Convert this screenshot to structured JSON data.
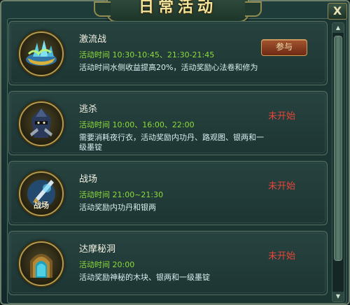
{
  "window": {
    "title": "日常活动",
    "close_label": "X"
  },
  "activities": [
    {
      "name": "激流战",
      "time": "活动时间 10:30-10:45、21:30-21:45",
      "desc": "活动时间水侧收益提高20%，活动奖励心法卷和修为",
      "action": "参与",
      "icon": "crystal-boat-icon"
    },
    {
      "name": "逃杀",
      "time": "活动时间 10:00、16:00、22:00",
      "desc": "需要消耗夜行衣，活动奖励内功丹、路观图、银两和一级墨锭",
      "status": "未开始",
      "icon": "masked-assassin-icon"
    },
    {
      "name": "战场",
      "time": "活动时间 21:00~21:30",
      "desc": "活动奖励内功丹和银两",
      "status": "未开始",
      "icon": "battlefield-sword-icon",
      "icon_text": "战场"
    },
    {
      "name": "达摩秘洞",
      "time": "活动时间 20:00",
      "desc": "活动奖励神秘的木块、银两和一级墨锭",
      "status": "未开始",
      "icon": "cave-portal-icon"
    }
  ],
  "colors": {
    "time_green": "#8ddc3a",
    "status_red": "#e8453a",
    "title_gold": "#f2e49a"
  }
}
